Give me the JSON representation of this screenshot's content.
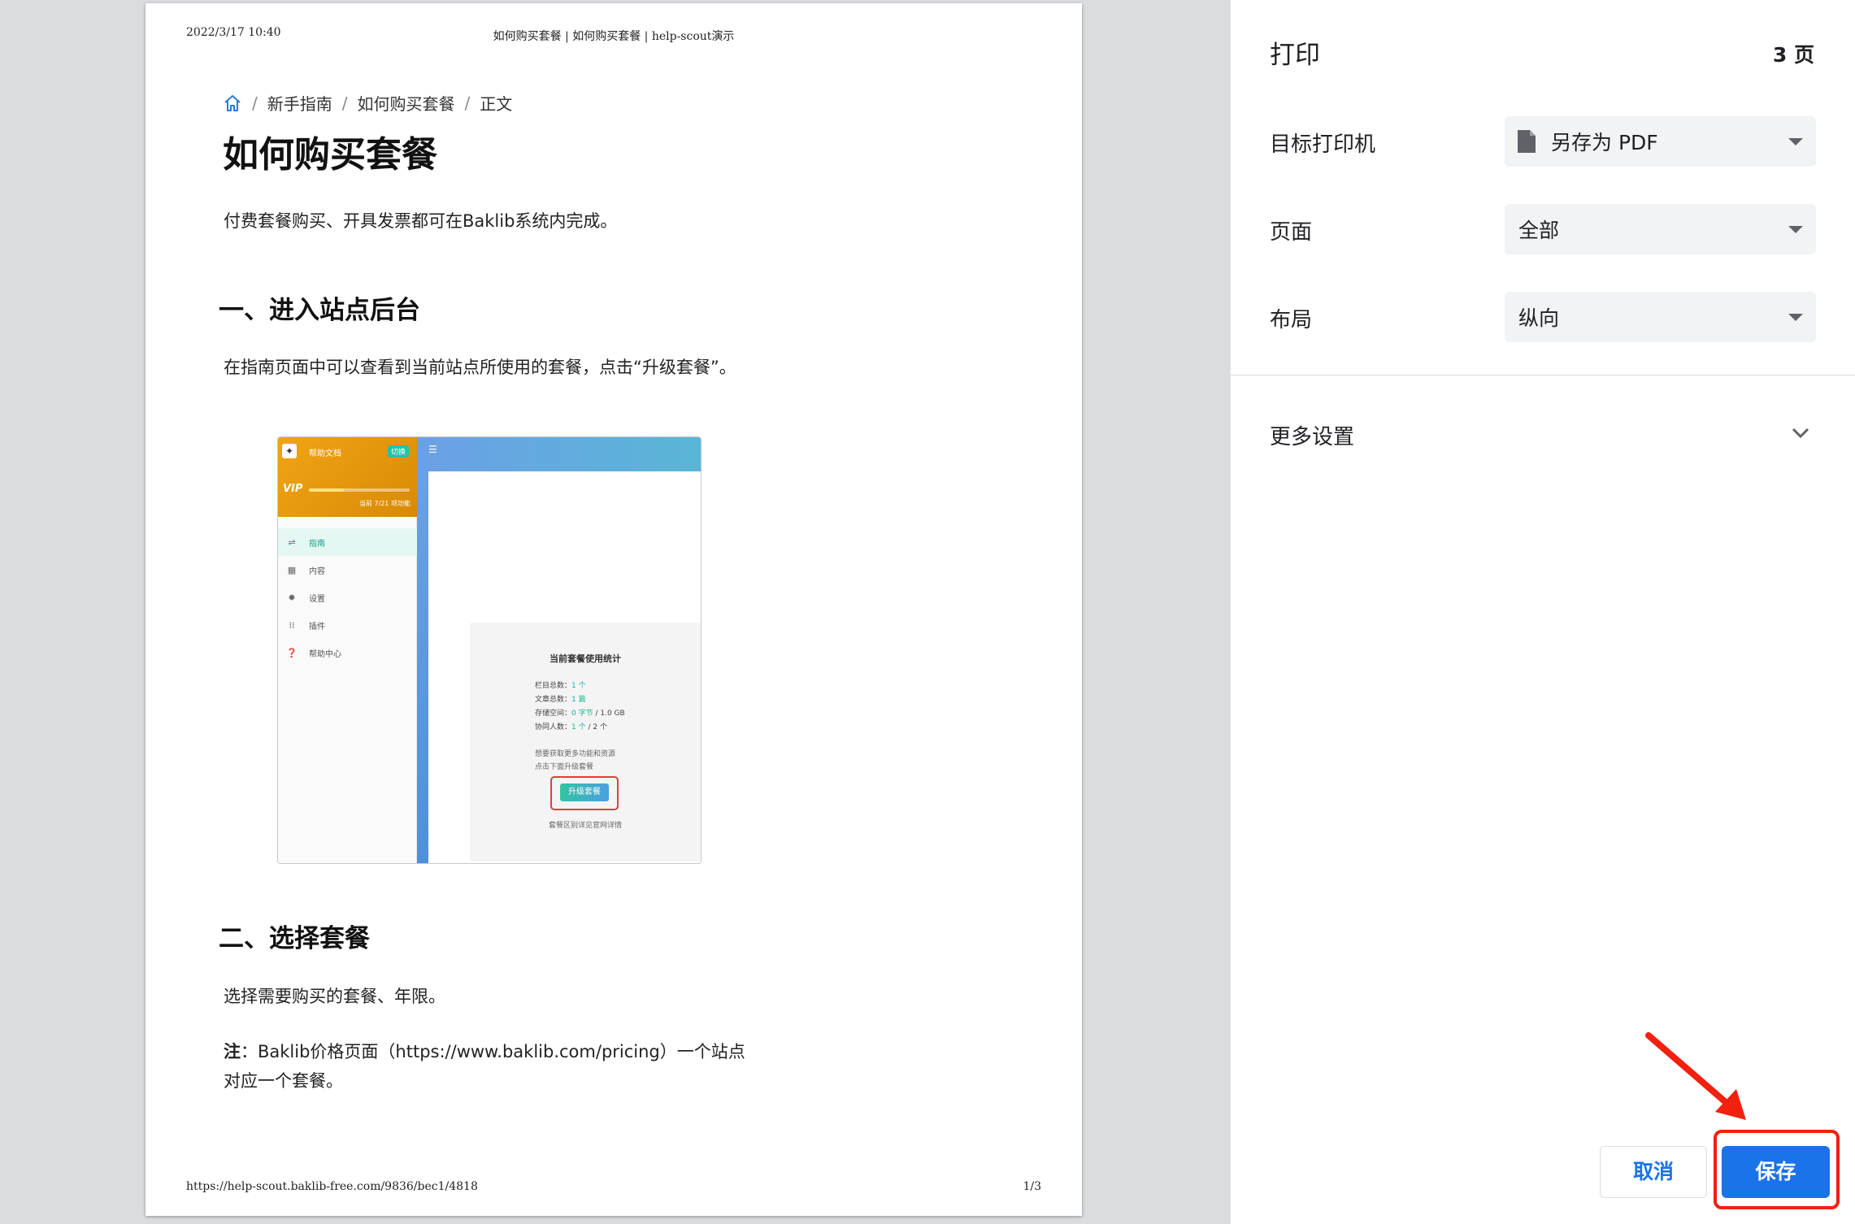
{
  "preview": {
    "header_date": "2022/3/17 10:40",
    "header_title": "如何购买套餐 | 如何购买套餐 | help-scout演示",
    "breadcrumb": [
      "新手指南",
      "如何购买套餐",
      "正文"
    ],
    "article_title": "如何购买套餐",
    "intro": "付费套餐购买、开具发票都可在Baklib系统内完成。",
    "section1_heading": "一、进入站点后台",
    "section1_text": "在指南页面中可以查看到当前站点所使用的套餐，点击“升级套餐”。",
    "section2_heading": "二、选择套餐",
    "section2_text": "选择需要购买的套餐、年限。",
    "note_label": "注",
    "note_text": "：Baklib价格页面（https://www.baklib.com/pricing）一个站点对应一个套餐。",
    "footer_url": "https://help-scout.baklib-free.com/9836/bec1/4818",
    "footer_page": "1/3",
    "screenshot": {
      "brand": "帮助文档",
      "switch": "切换",
      "vip": "VIP",
      "vip_progress": 0.35,
      "expire": "当前 7/21 项功能",
      "nav": [
        "指南",
        "内容",
        "设置",
        "插件",
        "帮助中心"
      ],
      "card_title": "当前套餐使用统计",
      "stats": [
        {
          "label": "栏目总数：",
          "value": "1 个",
          "extra": ""
        },
        {
          "label": "文章总数：",
          "value": "1 篇",
          "extra": ""
        },
        {
          "label": "存储空间：",
          "value": "0 字节",
          "extra": " / 1.0 GB"
        },
        {
          "label": "协同人数：",
          "value": "1 个",
          "extra": " / 2 个"
        }
      ],
      "tip1": "想要获取更多功能和资源",
      "tip2": "点击下面升级套餐",
      "upgrade_button": "升级套餐",
      "card_footer": "套餐区别详见官网详情"
    }
  },
  "panel": {
    "title": "打印",
    "sheet_count": "3 页",
    "destination_label": "目标打印机",
    "destination_value": "另存为 PDF",
    "pages_label": "页面",
    "pages_value": "全部",
    "layout_label": "布局",
    "layout_value": "纵向",
    "more_settings": "更多设置",
    "cancel": "取消",
    "save": "保存"
  },
  "colors": {
    "primary": "#1a73e8",
    "highlight": "#f2200f"
  }
}
